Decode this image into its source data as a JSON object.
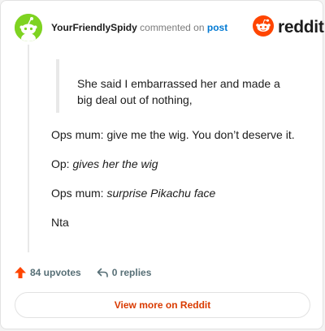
{
  "header": {
    "username": "YourFriendlySpidy",
    "action_text": "commented on",
    "post_link": "post",
    "brand": "reddit"
  },
  "comment": {
    "quote": "She said I embarrassed her and made a big deal out of nothing,",
    "paragraphs": [
      {
        "prefix": "Ops mum: give me the wig. You don’t deserve it.",
        "italic": ""
      },
      {
        "prefix": "Op: ",
        "italic": "gives her the wig"
      },
      {
        "prefix": "Ops mum: ",
        "italic": "surprise Pikachu face"
      },
      {
        "prefix": "Nta",
        "italic": ""
      }
    ]
  },
  "actions": {
    "upvotes": "84 upvotes",
    "replies": "0 replies"
  },
  "footer": {
    "view_more": "View more on Reddit"
  },
  "colors": {
    "brand": "#ff4500",
    "link": "#0079d3",
    "avatar_bg": "#7ed321",
    "view_more_text": "#d93a00"
  },
  "icons": {
    "avatar": "snoo-avatar-icon",
    "logo": "reddit-snoo-icon",
    "upvote": "upvote-arrow-icon",
    "reply": "reply-arrow-icon"
  }
}
